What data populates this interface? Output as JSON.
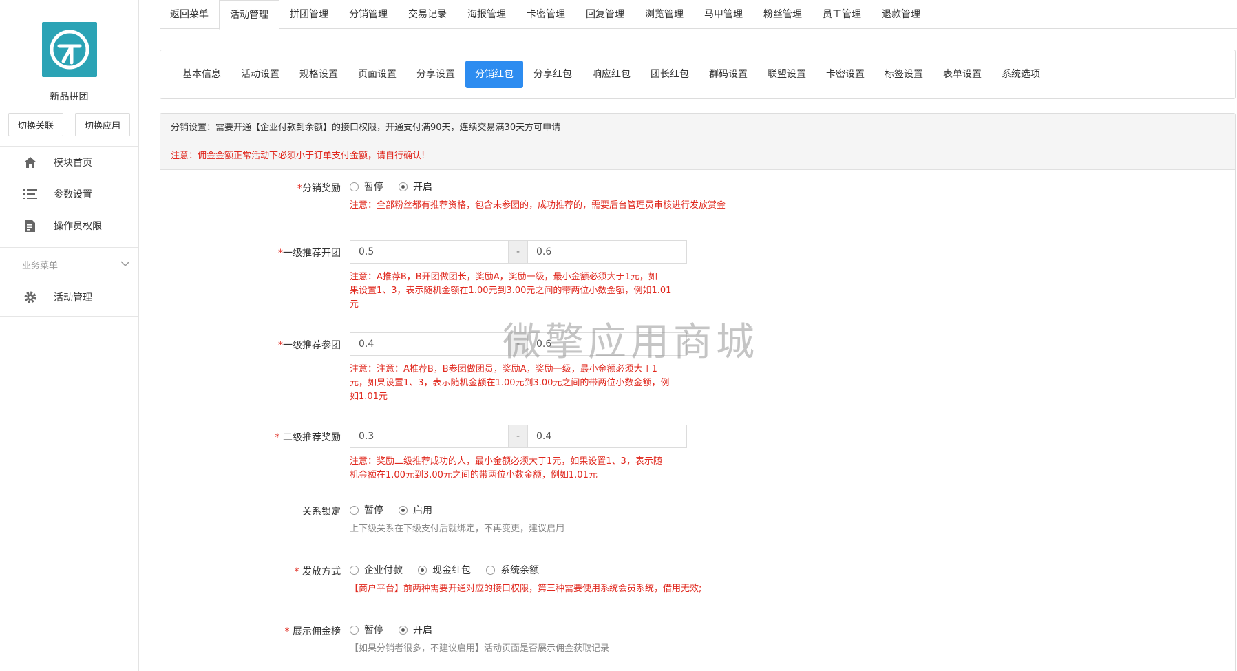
{
  "sidebar": {
    "app_name": "新品拼团",
    "switch_link": "切换关联",
    "switch_app": "切换应用",
    "items": [
      {
        "label": "模块首页",
        "icon": "home-icon"
      },
      {
        "label": "参数设置",
        "icon": "list-icon"
      },
      {
        "label": "操作员权限",
        "icon": "document-icon"
      }
    ],
    "section_title": "业务菜单",
    "section_items": [
      {
        "label": "活动管理",
        "icon": "gear-icon"
      }
    ]
  },
  "top_tabs": [
    "返回菜单",
    "活动管理",
    "拼团管理",
    "分销管理",
    "交易记录",
    "海报管理",
    "卡密管理",
    "回复管理",
    "浏览管理",
    "马甲管理",
    "粉丝管理",
    "员工管理",
    "退款管理"
  ],
  "top_tab_active": "活动管理",
  "sub_tabs": [
    "基本信息",
    "活动设置",
    "规格设置",
    "页面设置",
    "分享设置",
    "分销红包",
    "分享红包",
    "响应红包",
    "团长红包",
    "群码设置",
    "联盟设置",
    "卡密设置",
    "标签设置",
    "表单设置",
    "系统选项"
  ],
  "sub_tab_active": "分销红包",
  "notice": "分销设置：需要开通【企业付款到余额】的接口权限，开通支付满90天，连续交易满30天方可申请",
  "warning": "注意：佣金金额正常活动下必须小于订单支付金额，请自行确认!",
  "form": {
    "reward": {
      "label": "分销奖励",
      "options": [
        "暂停",
        "开启"
      ],
      "selected": "开启",
      "help": "注意：全部粉丝都有推荐资格，包含未参团的，成功推荐的，需要后台管理员审核进行发放赏金"
    },
    "level1_open": {
      "label": "一级推荐开团",
      "min": "0.5",
      "max": "0.6",
      "sep": "-",
      "help_lines": [
        "注意：A推荐B，B开团做团长，奖励A，奖励一级，最小金额必须大于1元，如",
        "果设置1、3，表示随机金额在1.00元到3.00元之间的带两位小数金额，例如1.01",
        "元"
      ]
    },
    "level1_join": {
      "label": "一级推荐参团",
      "min": "0.4",
      "max": "0.6",
      "sep": "-",
      "help_lines": [
        "注意：注意：A推荐B，B参团做团员，奖励A，奖励一级，最小金额必须大于1",
        "元，如果设置1、3，表示随机金额在1.00元到3.00元之间的带两位小数金额，例",
        "如1.01元"
      ]
    },
    "level2": {
      "label": " 二级推荐奖励",
      "min": "0.3",
      "max": "0.4",
      "sep": "-",
      "help_lines": [
        "注意：奖励二级推荐成功的人，最小金额必须大于1元，如果设置1、3，表示随",
        "机金额在1.00元到3.00元之间的带两位小数金额，例如1.01元"
      ]
    },
    "lock": {
      "label": "关系锁定",
      "options": [
        "暂停",
        "启用"
      ],
      "selected": "启用",
      "help": "上下级关系在下级支付后就绑定，不再变更，建议启用"
    },
    "payout": {
      "label": " 发放方式",
      "options": [
        "企业付款",
        "现金红包",
        "系统余额"
      ],
      "selected": "现金红包",
      "help": "【商户平台】前两种需要开通对应的接口权限，第三种需要使用系统会员系统，借用无效;"
    },
    "ranking": {
      "label": " 展示佣金榜",
      "options": [
        "暂停",
        "开启"
      ],
      "selected": "开启",
      "help": "【如果分销者很多，不建议启用】活动页面是否展示佣金获取记录"
    }
  },
  "watermark": "微擎应用商城",
  "colors": {
    "accent": "#2d8cf0",
    "logo": "#2ba3b5",
    "warning": "#e0281e"
  }
}
